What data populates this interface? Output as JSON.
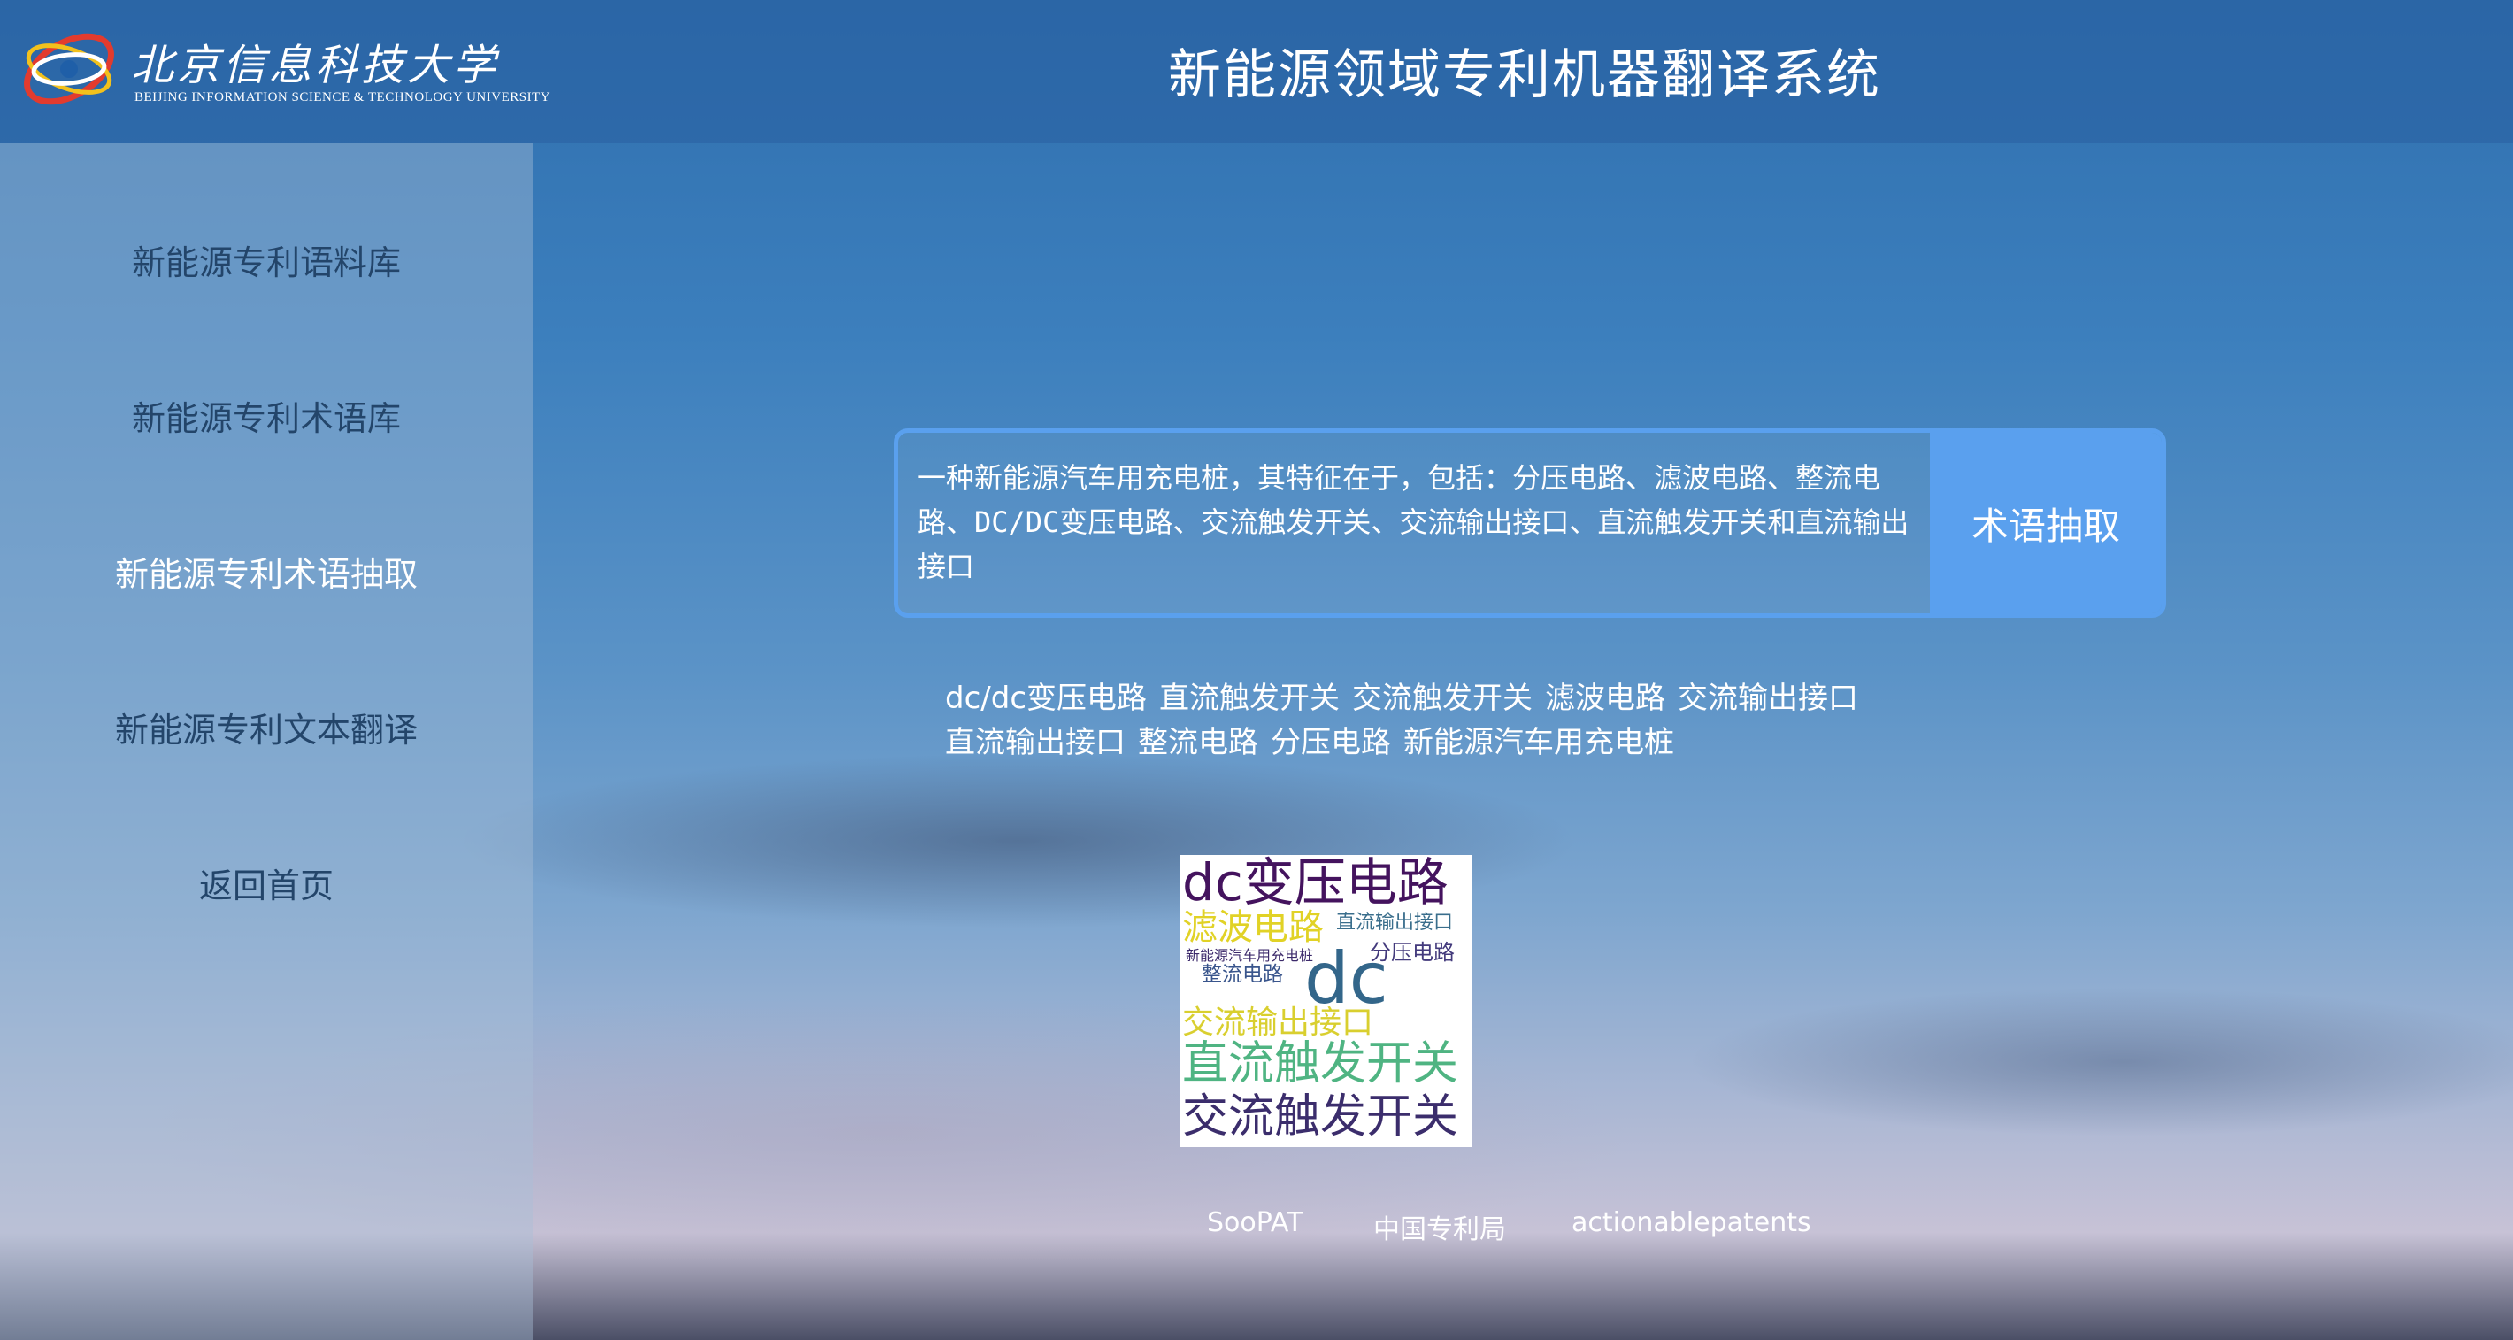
{
  "header": {
    "logo_cn": "北京信息科技大学",
    "logo_en": "BEIJING INFORMATION SCIENCE & TECHNOLOGY UNIVERSITY",
    "title": "新能源领域专利机器翻译系统"
  },
  "sidebar": {
    "items": [
      {
        "label": "新能源专利语料库",
        "active": false
      },
      {
        "label": "新能源专利术语库",
        "active": false
      },
      {
        "label": "新能源专利术语抽取",
        "active": true
      },
      {
        "label": "新能源专利文本翻译",
        "active": false
      },
      {
        "label": "返回首页",
        "active": false
      }
    ]
  },
  "extract": {
    "input_value": "一种新能源汽车用充电桩，其特征在于，包括：分压电路、滤波电路、整流电路、DC/DC变压电路、交流触发开关、交流输出接口、直流触发开关和直流输出接口",
    "button_label": "术语抽取"
  },
  "results": {
    "terms": [
      "dc/dc变压电路",
      "直流触发开关",
      "交流触发开关",
      "滤波电路",
      "交流输出接口",
      "直流输出接口",
      "整流电路",
      "分压电路",
      "新能源汽车用充电桩"
    ]
  },
  "wordcloud": {
    "words": [
      {
        "text": "dc变压电路",
        "color": "#44135e"
      },
      {
        "text": "滤波电路",
        "color": "#e1d226"
      },
      {
        "text": "直流输出接口",
        "color": "#3a6e8c"
      },
      {
        "text": "新能源汽车用充电桩",
        "color": "#3c2a6b"
      },
      {
        "text": "分压电路",
        "color": "#433a7c"
      },
      {
        "text": "整流电路",
        "color": "#39558c"
      },
      {
        "text": "dc",
        "color": "#33668a"
      },
      {
        "text": "交流输出接口",
        "color": "#d9cf2f"
      },
      {
        "text": "直流触发开关",
        "color": "#4fb482"
      },
      {
        "text": "交流触发开关",
        "color": "#3b2d6c"
      }
    ]
  },
  "footer": {
    "links": [
      "SooPAT",
      "中国专利局",
      "actionablepatents"
    ]
  },
  "colors": {
    "accent": "#5aa0ee",
    "sidebar_text": "#23456a",
    "active_text": "#ffffff"
  }
}
